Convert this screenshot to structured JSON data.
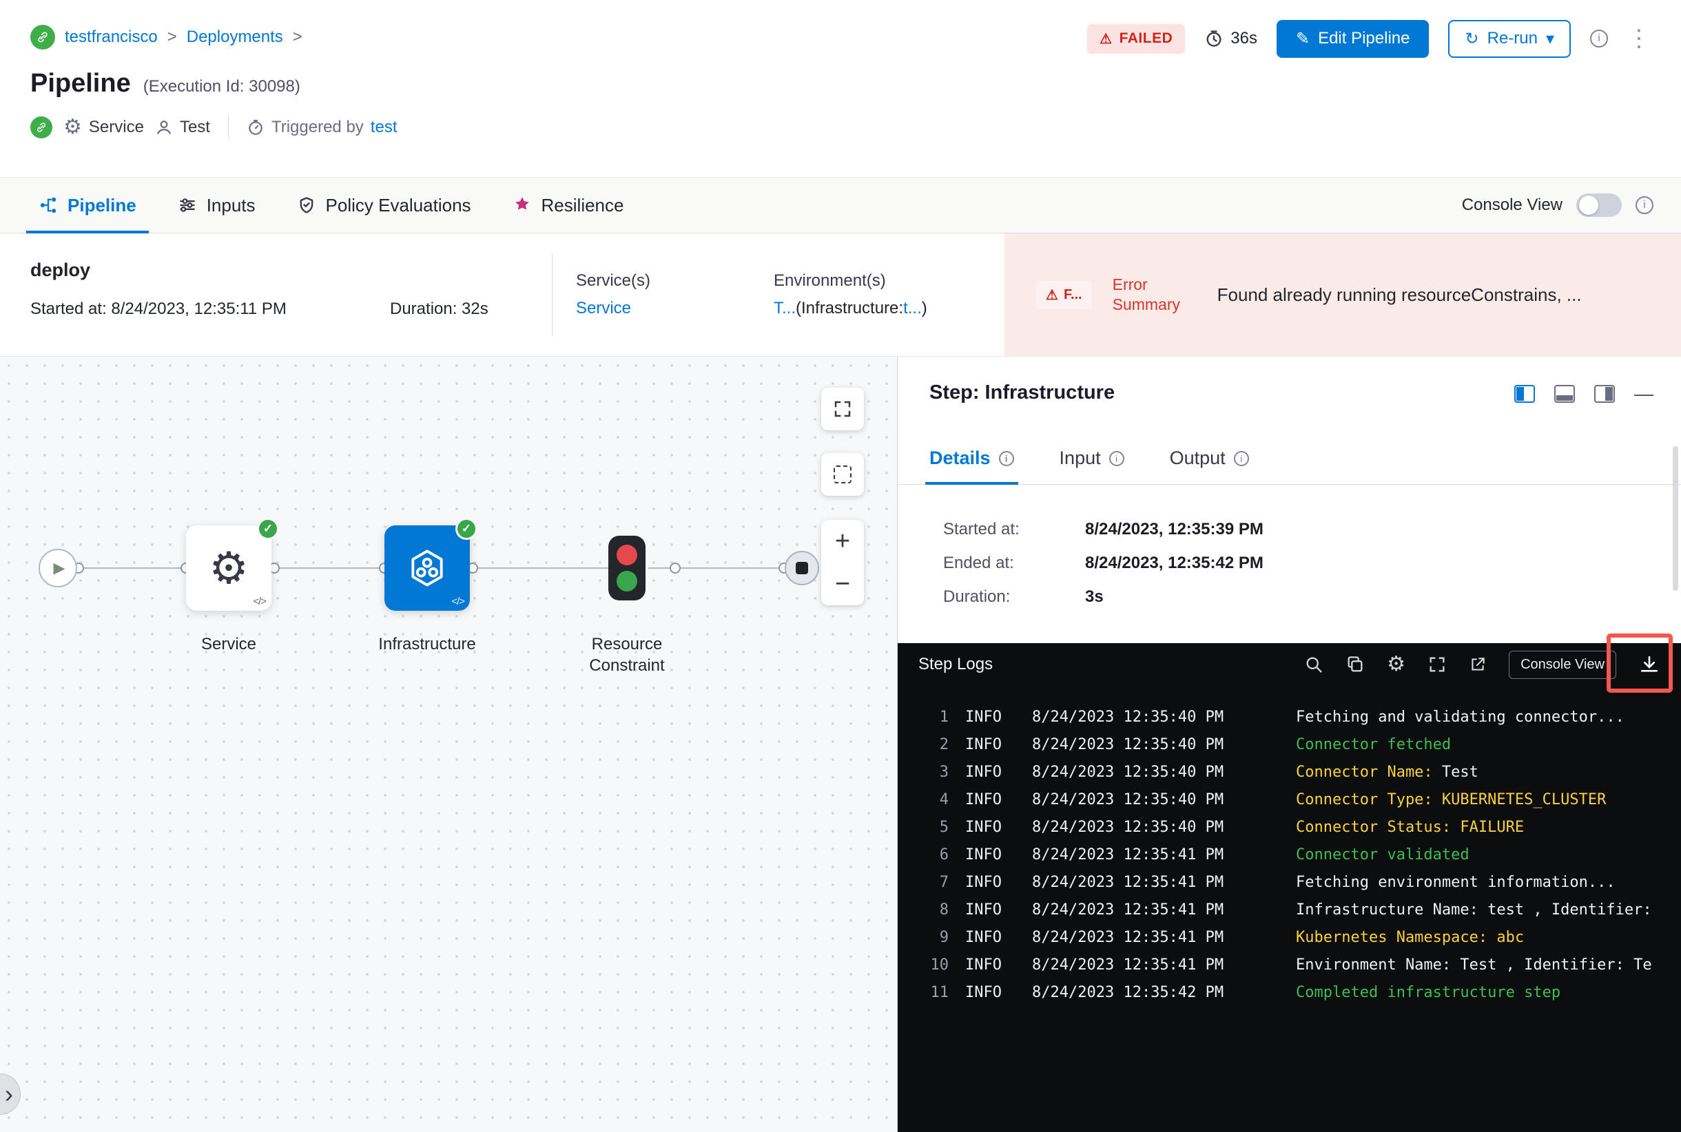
{
  "colors": {
    "accent_blue": "#0278d5",
    "error_red": "#cf2318",
    "error_bg": "#fbebe8",
    "success_green": "#3aa64c",
    "log_bg": "#0b0d0f",
    "log_green": "#3cbf4e",
    "log_yellow": "#fdd13a",
    "resilience_pink": "#c5317e"
  },
  "glyphs": {
    "breadcrumb_sep": ">",
    "warning": "⚠",
    "pencil": "✎",
    "refresh": "↻",
    "caret_down": "▾",
    "kebab": "⋮",
    "gear": "⚙",
    "play": "▶",
    "check": "✓",
    "code": "</>",
    "plus": "+",
    "minus": "−",
    "minimize": "—",
    "info_i": "i",
    "chevron_right": "›"
  },
  "header": {
    "breadcrumb": {
      "project": "testfrancisco",
      "section": "Deployments"
    },
    "title": "Pipeline",
    "execution_id": "(Execution Id: 30098)",
    "status_badge": "FAILED",
    "elapsed": "36s",
    "edit_pipeline_label": "Edit Pipeline",
    "rerun_label": "Re-run",
    "service_label": "Service",
    "test_label": "Test",
    "triggered_by_label": "Triggered by",
    "triggered_by_value": "test"
  },
  "tabs": {
    "pipeline": "Pipeline",
    "inputs": "Inputs",
    "policy": "Policy Evaluations",
    "resilience": "Resilience",
    "console_view_label": "Console View"
  },
  "summary": {
    "stage_name": "deploy",
    "started": "Started at: 8/24/2023, 12:35:11 PM",
    "duration": "Duration: 32s",
    "services_label": "Service(s)",
    "services_value": "Service",
    "environments_label": "Environment(s)",
    "env_value_link1": "T...",
    "env_value_mid": "(Infrastructure:",
    "env_value_link2": "t...",
    "env_value_end": ")",
    "error_badge": "F...",
    "error_summary_label": "Error Summary",
    "error_text": "Found already running resourceConstrains, ..."
  },
  "canvas": {
    "node_service": "Service",
    "node_infrastructure": "Infrastructure",
    "node_resource_constraint": "Resource Constraint"
  },
  "step_panel": {
    "title": "Step: Infrastructure",
    "tab_details": "Details",
    "tab_input": "Input",
    "tab_output": "Output",
    "started_label": "Started at:",
    "started_value": "8/24/2023, 12:35:39 PM",
    "ended_label": "Ended at:",
    "ended_value": "8/24/2023, 12:35:42 PM",
    "duration_label": "Duration:",
    "duration_value": "3s"
  },
  "logs": {
    "title": "Step Logs",
    "console_view_button": "Console View",
    "lines": [
      {
        "num": "1",
        "level": "INFO",
        "time": "8/24/2023 12:35:40 PM",
        "segments": [
          {
            "text": "Fetching and validating connector...",
            "color": "white"
          }
        ]
      },
      {
        "num": "2",
        "level": "INFO",
        "time": "8/24/2023 12:35:40 PM",
        "segments": [
          {
            "text": "Connector fetched",
            "color": "green"
          }
        ]
      },
      {
        "num": "3",
        "level": "INFO",
        "time": "8/24/2023 12:35:40 PM",
        "segments": [
          {
            "text": "Connector Name: ",
            "color": "yellow"
          },
          {
            "text": "Test",
            "color": "white"
          }
        ]
      },
      {
        "num": "4",
        "level": "INFO",
        "time": "8/24/2023 12:35:40 PM",
        "segments": [
          {
            "text": "Connector Type: KUBERNETES_CLUSTER",
            "color": "yellow"
          }
        ]
      },
      {
        "num": "5",
        "level": "INFO",
        "time": "8/24/2023 12:35:40 PM",
        "segments": [
          {
            "text": "Connector Status: FAILURE",
            "color": "yellow"
          }
        ]
      },
      {
        "num": "6",
        "level": "INFO",
        "time": "8/24/2023 12:35:41 PM",
        "segments": [
          {
            "text": "Connector validated",
            "color": "green"
          }
        ]
      },
      {
        "num": "7",
        "level": "INFO",
        "time": "8/24/2023 12:35:41 PM",
        "segments": [
          {
            "text": "Fetching environment information...",
            "color": "white"
          }
        ]
      },
      {
        "num": "8",
        "level": "INFO",
        "time": "8/24/2023 12:35:41 PM",
        "segments": [
          {
            "text": "Infrastructure Name: test , Identifier:",
            "color": "white"
          }
        ]
      },
      {
        "num": "9",
        "level": "INFO",
        "time": "8/24/2023 12:35:41 PM",
        "segments": [
          {
            "text": "Kubernetes Namespace: abc",
            "color": "yellow"
          }
        ]
      },
      {
        "num": "10",
        "level": "INFO",
        "time": "8/24/2023 12:35:41 PM",
        "segments": [
          {
            "text": "Environment Name: Test , Identifier: Te",
            "color": "white"
          }
        ]
      },
      {
        "num": "11",
        "level": "INFO",
        "time": "8/24/2023 12:35:42 PM",
        "segments": [
          {
            "text": "Completed infrastructure step",
            "color": "green"
          }
        ]
      }
    ]
  }
}
